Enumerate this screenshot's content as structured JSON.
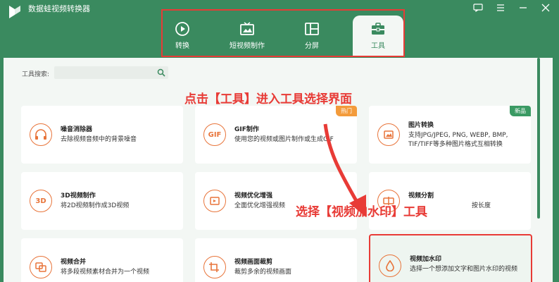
{
  "app": {
    "title": "数据蛙视频转换器"
  },
  "window_controls": {
    "chat": "chat-icon",
    "menu": "menu-icon",
    "minimize": "minimize-icon",
    "close": "close-icon"
  },
  "tabs": [
    {
      "label": "转换",
      "icon": "convert-icon"
    },
    {
      "label": "短视频制作",
      "icon": "short-video-icon"
    },
    {
      "label": "分屏",
      "icon": "split-screen-icon"
    },
    {
      "label": "工具",
      "icon": "toolbox-icon"
    }
  ],
  "search": {
    "label": "工具搜索:",
    "placeholder": ""
  },
  "annotations": {
    "top": "点击【工具】进入工具选择界面",
    "middle": "选择【视频加水印】工具"
  },
  "tools": [
    {
      "title": "噪音消除器",
      "desc": "去除视频音频中的背景噪音",
      "icon": "headphones-icon"
    },
    {
      "title": "GIF制作",
      "desc": "使用您的视频或图片制作或生成GIF",
      "icon": "gif-icon",
      "icon_text": "GIF",
      "badge": "热门"
    },
    {
      "title": "图片转换",
      "desc": "支持JPG/JPEG, PNG, WEBP, BMP, TIF/TIFF等多种图片格式互相转换",
      "icon": "image-convert-icon",
      "badge": "新品"
    },
    {
      "title": "3D视频制作",
      "desc": "将2D视频制作成3D视频",
      "icon": "3d-icon",
      "icon_text": "3D"
    },
    {
      "title": "视频优化增强",
      "desc": "全面优化增强视频",
      "icon": "enhance-icon"
    },
    {
      "title": "视频分割",
      "desc": "按长度",
      "icon": "split-icon"
    },
    {
      "title": "视频合并",
      "desc": "将多段视频素材合并为一个视频",
      "icon": "merge-icon"
    },
    {
      "title": "视频画面裁剪",
      "desc": "裁剪多余的视频画面",
      "icon": "crop-icon"
    },
    {
      "title": "视频加水印",
      "desc": "选择一个想添加文字和图片水印的视频",
      "icon": "watermark-icon"
    }
  ],
  "colors": {
    "brand": "#3a8a5f",
    "accent": "#e8743a",
    "highlight": "#e83b36",
    "hot": "#f39b3b",
    "new": "#3a9a63"
  }
}
